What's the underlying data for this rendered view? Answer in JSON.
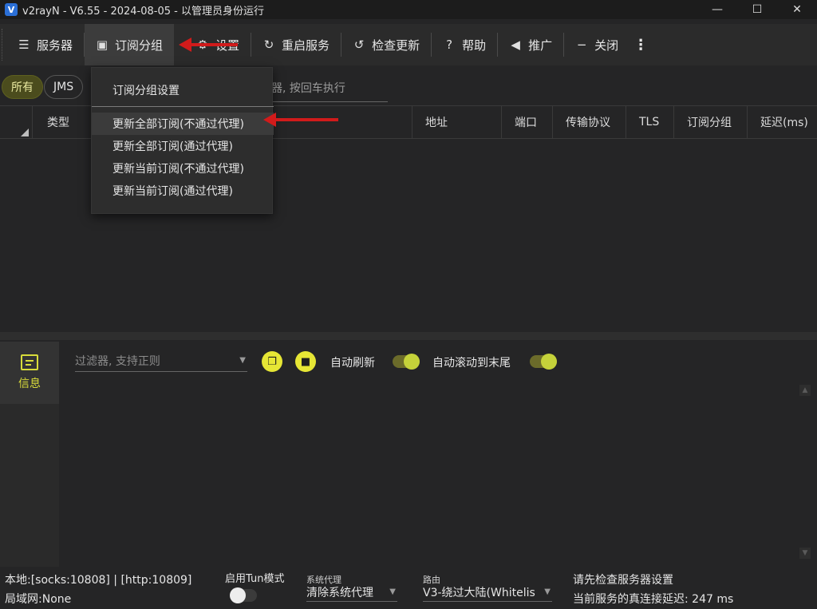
{
  "window": {
    "title": "v2rayN - V6.55 - 2024-08-05 - 以管理员身份运行",
    "logo_glyph": "V",
    "controls": {
      "minimize": "—",
      "maximize": "☐",
      "close": "✕"
    }
  },
  "toolbar": {
    "items": [
      {
        "label": "服务器",
        "icon": "server-icon"
      },
      {
        "label": "订阅分组",
        "icon": "subscription-icon",
        "active": true
      },
      {
        "label": "设置",
        "icon": "settings-icon"
      },
      {
        "label": "重启服务",
        "icon": "restart-icon"
      },
      {
        "label": "检查更新",
        "icon": "update-icon"
      },
      {
        "label": "帮助",
        "icon": "help-icon"
      },
      {
        "label": "推广",
        "icon": "promote-icon"
      },
      {
        "label": "关闭",
        "icon": "minus-icon"
      }
    ],
    "more": "⋮"
  },
  "filters": {
    "chips": [
      {
        "label": "所有",
        "active": true
      },
      {
        "label": "JMS",
        "active": false
      }
    ],
    "search_placeholder": "器, 按回车执行"
  },
  "grid": {
    "columns": [
      "类型",
      "地址",
      "端口",
      "传输协议",
      "TLS",
      "订阅分组",
      "延迟(ms)"
    ]
  },
  "dropdown": {
    "header": "订阅分组设置",
    "items": [
      "更新全部订阅(不通过代理)",
      "更新全部订阅(通过代理)",
      "更新当前订阅(不通过代理)",
      "更新当前订阅(通过代理)"
    ]
  },
  "log": {
    "tab_label": "信息",
    "filter_placeholder": "过滤器, 支持正则",
    "auto_refresh": "自动刷新",
    "auto_scroll": "自动滚动到末尾",
    "auto_refresh_on": true,
    "auto_scroll_on": true
  },
  "status": {
    "local": "本地:[socks:10808] | [http:10809]",
    "lan": "局域网:None",
    "tun_label": "启用Tun模式",
    "tun_on": false,
    "sys_proxy_label": "系统代理",
    "sys_proxy_value": "清除系统代理",
    "routing_label": "路由",
    "routing_value": "V3-绕过大陆(Whitelis",
    "message": "请先检查服务器设置",
    "latency": "当前服务的真连接延迟: 247 ms"
  },
  "colors": {
    "accent": "#d8dc3a",
    "arrow": "#d11b1b",
    "background": "#252526"
  }
}
